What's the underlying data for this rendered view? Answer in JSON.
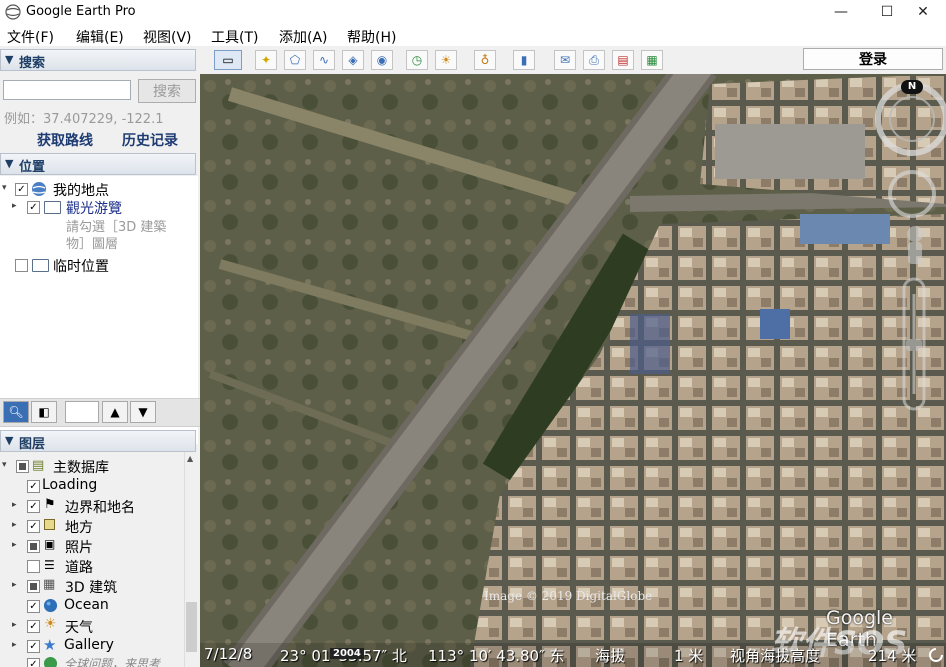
{
  "window": {
    "title": "Google Earth Pro",
    "minimize": "—",
    "maximize": "☐",
    "close": "✕"
  },
  "menu": [
    "文件(F)",
    "编辑(E)",
    "视图(V)",
    "工具(T)",
    "添加(A)",
    "帮助(H)"
  ],
  "search": {
    "header": "搜索",
    "placeholder": "",
    "button": "搜索",
    "hint": "例如：37.407229, -122.1",
    "get_directions": "获取路线",
    "history": "历史记录"
  },
  "places": {
    "header": "位置",
    "my_places": "我的地点",
    "sightseeing": "觀光游覽",
    "hint_line1": "請勾選［3D 建築",
    "hint_line2": "物］圖層",
    "temporary": "临时位置"
  },
  "layers": {
    "header": "图层",
    "items": [
      {
        "label": "主数据库",
        "level": 0
      },
      {
        "label": "Loading",
        "level": 1
      },
      {
        "label": "边界和地名",
        "level": 1
      },
      {
        "label": "地方",
        "level": 1
      },
      {
        "label": "照片",
        "level": 1
      },
      {
        "label": "道路",
        "level": 1
      },
      {
        "label": "3D 建筑",
        "level": 1
      },
      {
        "label": "Ocean",
        "level": 1
      },
      {
        "label": "天气",
        "level": 1
      },
      {
        "label": "Gallery",
        "level": 1
      },
      {
        "label": "全球问题，来思考",
        "level": 1
      }
    ]
  },
  "toolbar": {
    "sign_in": "登录"
  },
  "map": {
    "attribution": "Image © 2019 DigitalGlobe",
    "brand": "Google Earth",
    "watermark": "软件SOS",
    "compass_n": "N",
    "year": "2004"
  },
  "status": {
    "date": "7/12/8",
    "lat": "23° 01′ 35.57″ 北",
    "lon": "113° 10′ 43.80″ 东",
    "elev_label": "海拔",
    "elev_value": "1 米",
    "eye_label": "视角海拔高度",
    "eye_value": "214 米"
  },
  "colors": {
    "section_header_text": "#1f3f66",
    "link_text": "#1e3b73",
    "map_bg": "#4f5640"
  }
}
